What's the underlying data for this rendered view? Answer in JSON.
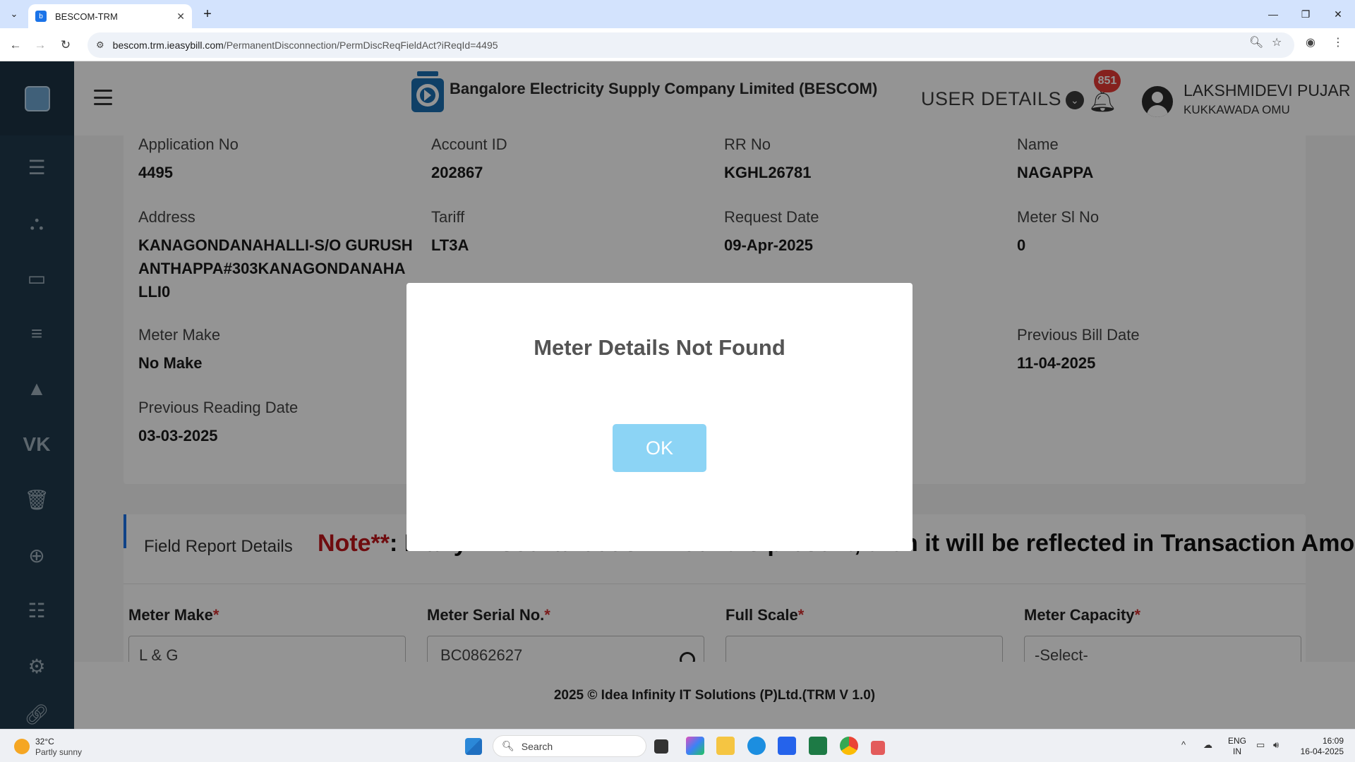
{
  "browser": {
    "tab_title": "BESCOM-TRM",
    "url_host": "bescom.trm.ieasybill.com",
    "url_path": "/PermanentDisconnection/PermDiscReqFieldAct?iReqId=4495"
  },
  "header": {
    "company_name": "Bangalore Electricity Supply Company Limited (BESCOM)",
    "user_details_label": "USER DETAILS",
    "notification_count": "851",
    "user_name": "LAKSHMIDEVI PUJAR",
    "user_location": "KUKKAWADA OMU"
  },
  "sidebar": {
    "icons": [
      "table-icon",
      "sitemap-icon",
      "desktop-icon",
      "numbered-list-icon",
      "road-icon",
      "vk-icon",
      "trash-icon",
      "plus-circle-icon",
      "list-icon",
      "cogs-icon",
      "link-icon"
    ]
  },
  "details": {
    "application_no": {
      "label": "Application No",
      "value": "4495"
    },
    "account_id": {
      "label": "Account ID",
      "value": "202867"
    },
    "rr_no": {
      "label": "RR No",
      "value": "KGHL26781"
    },
    "name": {
      "label": "Name",
      "value": "NAGAPPA"
    },
    "address": {
      "label": "Address",
      "value": "KANAGONDANAHALLI-S/O GURUSHANTHAPPA#303KANAGONDANAHALLI0"
    },
    "tariff": {
      "label": "Tariff",
      "value": "LT3A"
    },
    "request_date": {
      "label": "Request Date",
      "value": "09-Apr-2025"
    },
    "meter_sl_no": {
      "label": "Meter Sl No",
      "value": "0"
    },
    "meter_make": {
      "label": "Meter Make",
      "value": "No Make"
    },
    "previous_bill_date": {
      "label": "Previous Bill Date",
      "value": "11-04-2025"
    },
    "previous_reading_date": {
      "label": "Previous Reading Date",
      "value": "03-03-2025"
    }
  },
  "field_report": {
    "title": "Field Report Details",
    "note_prefix": "Note**",
    "note_text": ": If any Miscellaneous Amount is present, then it will be reflected in Transaction Amount.",
    "meter_make_label": "Meter Make",
    "meter_make_value": "L & G",
    "meter_serial_label": "Meter Serial No.",
    "meter_serial_value": "BC0862627",
    "full_scale_label": "Full Scale",
    "full_scale_value": "",
    "meter_capacity_label": "Meter Capacity",
    "meter_capacity_value": "-Select-",
    "required_marker": "*"
  },
  "footer": {
    "text": "2025 © Idea Infinity IT Solutions (P)Ltd.(TRM V 1.0)"
  },
  "modal": {
    "title": "Meter Details Not Found",
    "ok_label": "OK"
  },
  "taskbar": {
    "temperature": "32°C",
    "weather": "Partly sunny",
    "search_placeholder": "Search",
    "lang_top": "ENG",
    "lang_bottom": "IN",
    "time": "16:09",
    "date": "16-04-2025"
  }
}
